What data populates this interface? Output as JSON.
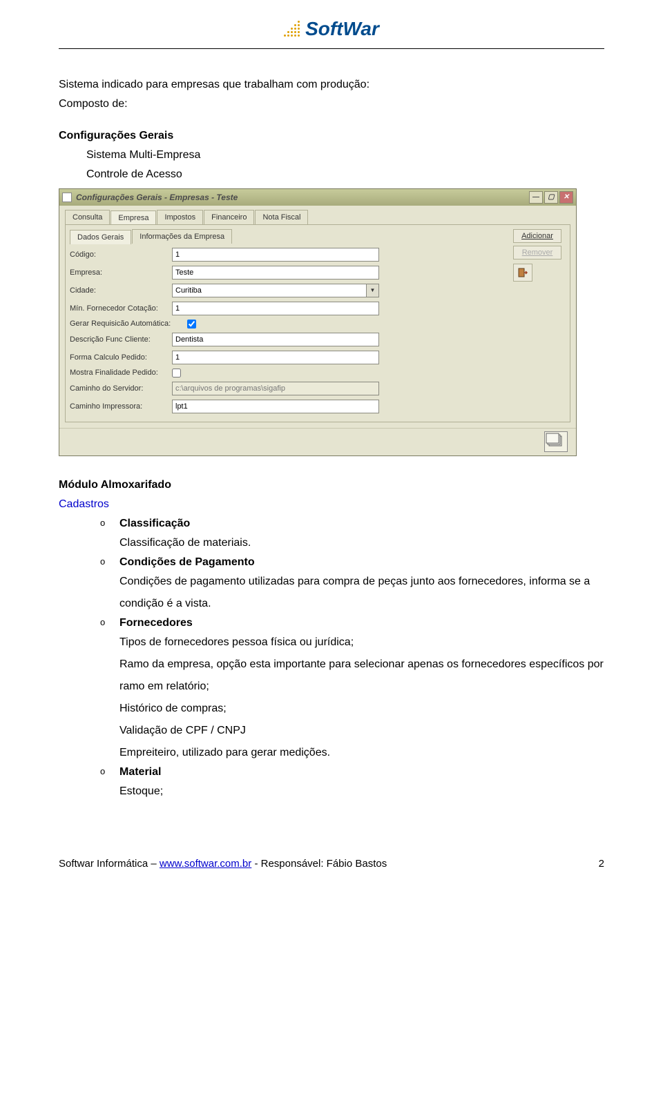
{
  "header": {
    "logo_text": "SoftWar"
  },
  "intro": {
    "line1": "Sistema indicado para empresas que trabalham com produção:",
    "line2": "Composto de:"
  },
  "config": {
    "title": "Configurações Gerais",
    "item1": "Sistema Multi-Empresa",
    "item2": "Controle de Acesso"
  },
  "window": {
    "title": "Configurações Gerais - Empresas - Teste",
    "tabs": [
      "Consulta",
      "Empresa",
      "Impostos",
      "Financeiro",
      "Nota Fiscal"
    ],
    "active_tab": 1,
    "subtabs": [
      "Dados Gerais",
      "Informações da Empresa"
    ],
    "active_subtab": 0,
    "side": {
      "add": "Adicionar",
      "remove": "Remover"
    },
    "fields": {
      "codigo": {
        "label": "Código:",
        "value": "1"
      },
      "empresa": {
        "label": "Empresa:",
        "value": "Teste"
      },
      "cidade": {
        "label": "Cidade:",
        "value": "Curitiba"
      },
      "min_forn": {
        "label": "Mín. Fornecedor Cotação:",
        "value": "1"
      },
      "gerar_req": {
        "label": "Gerar Requisicão Automática:",
        "checked": true
      },
      "descr_func": {
        "label": "Descrição Func Cliente:",
        "value": "Dentista"
      },
      "forma_calc": {
        "label": "Forma Calculo Pedido:",
        "value": "1"
      },
      "mostra_fin": {
        "label": "Mostra Finalidade Pedido:",
        "checked": false
      },
      "caminho_srv": {
        "label": "Caminho do Servidor:",
        "value": "c:\\arquivos de programas\\sigafip"
      },
      "caminho_imp": {
        "label": "Caminho Impressora:",
        "value": "lpt1"
      }
    }
  },
  "modulo": {
    "title": "Módulo Almoxarifado",
    "cadastros": "Cadastros",
    "bullet_marker": "o",
    "items": {
      "classificacao": {
        "title": "Classificação",
        "line1": "Classificação de materiais."
      },
      "condicoes": {
        "title": "Condições de Pagamento",
        "line1": "Condições de pagamento utilizadas para compra de peças junto aos fornecedores, informa se a condição é a vista."
      },
      "fornecedores": {
        "title": "Fornecedores",
        "l1": "Tipos de fornecedores pessoa física ou jurídica;",
        "l2": "Ramo da empresa, opção esta importante para selecionar apenas os fornecedores específicos por ramo em relatório;",
        "l3": "Histórico de compras;",
        "l4": "Validação de CPF / CNPJ",
        "l5": "Empreiteiro, utilizado para gerar medições."
      },
      "material": {
        "title": "Material",
        "l1": "Estoque;"
      }
    }
  },
  "footer": {
    "left_pre": "Softwar Informática – ",
    "link": "www.softwar.com.br",
    "left_post": " - Responsável: Fábio Bastos",
    "page": "2"
  }
}
